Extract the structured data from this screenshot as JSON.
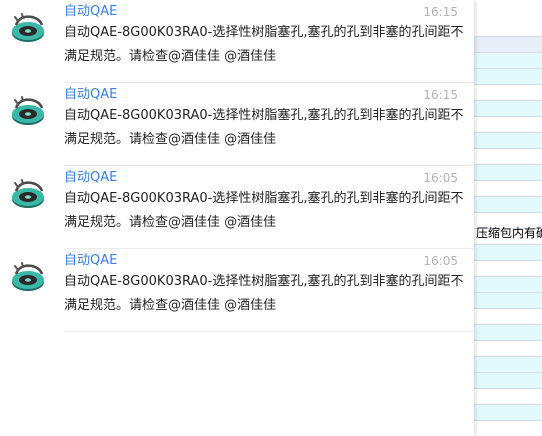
{
  "background_sheet": {
    "cell_text": "压缩包内有确"
  },
  "messages": [
    {
      "sender": "自动QAE",
      "time": "16:15",
      "text": "自动QAE-8G00K03RA0-选择性树脂塞孔,塞孔的孔到非塞的孔间距不满足规范。请检查@酒佳佳 @酒佳佳"
    },
    {
      "sender": "自动QAE",
      "time": "16:15",
      "text": "自动QAE-8G00K03RA0-选择性树脂塞孔,塞孔的孔到非塞的孔间距不满足规范。请检查@酒佳佳 @酒佳佳"
    },
    {
      "sender": "自动QAE",
      "time": "16:05",
      "text": "自动QAE-8G00K03RA0-选择性树脂塞孔,塞孔的孔到非塞的孔间距不满足规范。请检查@酒佳佳 @酒佳佳"
    },
    {
      "sender": "自动QAE",
      "time": "16:05",
      "text": "自动QAE-8G00K03RA0-选择性树脂塞孔,塞孔的孔到非塞的孔间距不满足规范。请检查@酒佳佳 @酒佳佳"
    }
  ],
  "colors": {
    "sender": "#3a7fd8",
    "time": "#b4b4b4",
    "text": "#222222",
    "sheet_cyan": "#e3fafd"
  },
  "icons": {
    "avatar": "disc-avatar-icon"
  }
}
